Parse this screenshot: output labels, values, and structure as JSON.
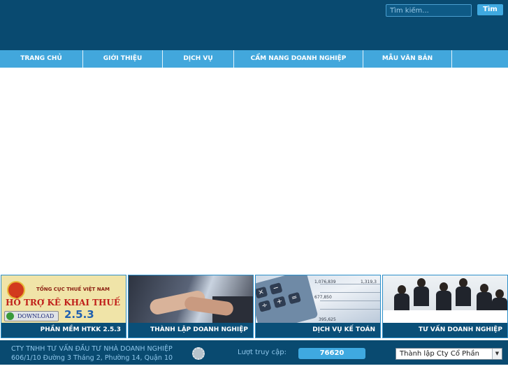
{
  "search": {
    "placeholder": "Tìm kiếm...",
    "button_label": "Tìm"
  },
  "nav": {
    "items": [
      {
        "label": "TRANG CHỦ"
      },
      {
        "label": "GIỚI THIỆU"
      },
      {
        "label": "DỊCH VỤ"
      },
      {
        "label": "CẨM NANG DOANH NGHIỆP"
      },
      {
        "label": "MẪU VĂN BẢN"
      }
    ]
  },
  "tiles": [
    {
      "caption": "PHẦN MỀM HTKK 2.5.3",
      "image": {
        "agency": "TỔNG CỤC THUẾ VIỆT NAM",
        "headline": "HỖ TRỢ KÊ KHAI THUẾ",
        "download_label": "DOWNLOAD",
        "version": "2.5.3"
      }
    },
    {
      "caption": "THÀNH LẬP DOANH NGHIỆP"
    },
    {
      "caption": "DỊCH VỤ KẾ TOÁN",
      "image": {
        "ledger_values": [
          "1,076,839",
          "677,850",
          "1,319,3",
          "395,625"
        ]
      }
    },
    {
      "caption": "TƯ VẤN DOANH NGHIỆP"
    }
  ],
  "footer": {
    "company_name": "CTY TNHH TƯ VẤN ĐẦU TƯ NHÀ DOANH NGHIỆP",
    "address": "606/1/10 Đường 3 Tháng 2, Phường 14, Quận 10",
    "visit_label": "Lượt truy cập:",
    "visit_count": "76620",
    "select_value": "Thành lập Cty Cổ Phần"
  },
  "colors": {
    "header_bg": "#094a70",
    "nav_bg": "#42a7dc",
    "accent": "#3fa9e0",
    "footer_text": "#8ec6ea"
  },
  "icons": {
    "search_button": "search-button",
    "footer_logo": "gear-icon",
    "select_arrow": "chevron-down-icon"
  }
}
